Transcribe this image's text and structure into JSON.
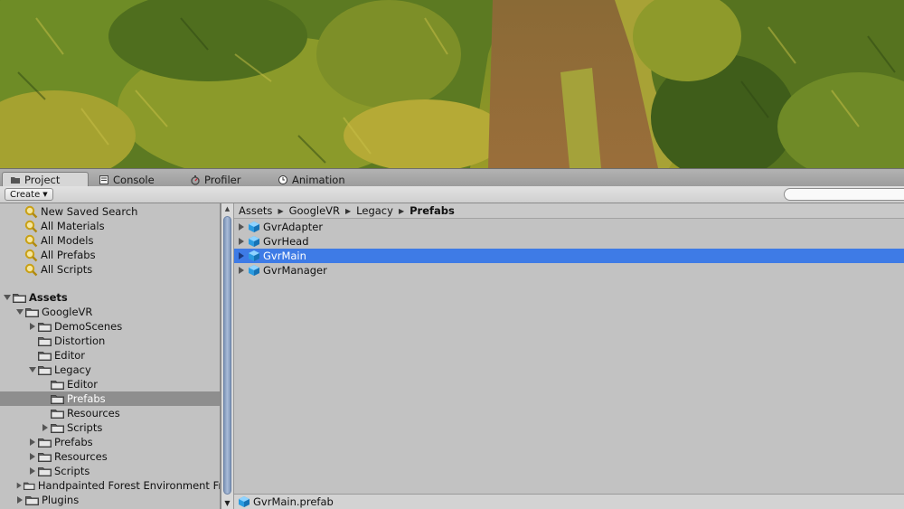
{
  "tabs": [
    {
      "label": "Project",
      "icon": "folder-icon",
      "active": true
    },
    {
      "label": "Console",
      "icon": "console-icon",
      "active": false
    },
    {
      "label": "Profiler",
      "icon": "profiler-icon",
      "active": false
    },
    {
      "label": "Animation",
      "icon": "clock-icon",
      "active": false
    }
  ],
  "toolbar": {
    "create_label": "Create",
    "search_value": ""
  },
  "favorites": [
    {
      "label": "New Saved Search"
    },
    {
      "label": "All Materials"
    },
    {
      "label": "All Models"
    },
    {
      "label": "All Prefabs"
    },
    {
      "label": "All Scripts"
    }
  ],
  "tree": {
    "assets": "Assets",
    "googlevr": "GoogleVR",
    "demoscenes": "DemoScenes",
    "distortion": "Distortion",
    "editor": "Editor",
    "legacy": "Legacy",
    "legacy_editor": "Editor",
    "legacy_prefabs": "Prefabs",
    "legacy_resources": "Resources",
    "legacy_scripts": "Scripts",
    "prefabs": "Prefabs",
    "resources": "Resources",
    "scripts": "Scripts",
    "handpainted": "Handpainted Forest Environment Free",
    "plugins": "Plugins"
  },
  "breadcrumb": [
    "Assets",
    "GoogleVR",
    "Legacy",
    "Prefabs"
  ],
  "assets": [
    {
      "label": "GvrAdapter",
      "selected": false
    },
    {
      "label": "GvrHead",
      "selected": false
    },
    {
      "label": "GvrMain",
      "selected": true
    },
    {
      "label": "GvrManager",
      "selected": false
    }
  ],
  "status": {
    "selected_file": "GvrMain.prefab"
  },
  "colors": {
    "selection_blue": "#3e7be6",
    "tree_selection": "#8e8e8e",
    "prefab_cube": "#2a9be0"
  }
}
